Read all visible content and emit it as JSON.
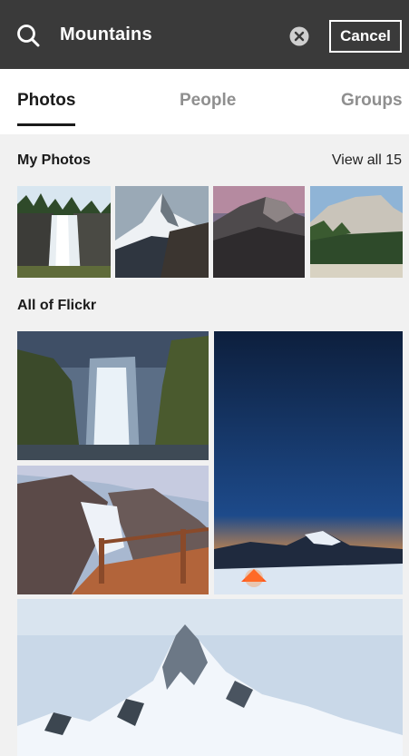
{
  "search": {
    "query": "Mountains",
    "cancel_label": "Cancel"
  },
  "tabs": [
    {
      "label": "Photos",
      "active": true
    },
    {
      "label": "People",
      "active": false
    },
    {
      "label": "Groups",
      "active": false
    }
  ],
  "my_photos": {
    "title": "My Photos",
    "view_all_label": "View all 15"
  },
  "all_of_flickr": {
    "title": "All of Flickr"
  },
  "colors": {
    "header_bg": "#3a3a3a",
    "content_bg": "#f1f1f1",
    "active_tab": "#1a1a1a",
    "inactive_tab": "#8f8f8f"
  }
}
